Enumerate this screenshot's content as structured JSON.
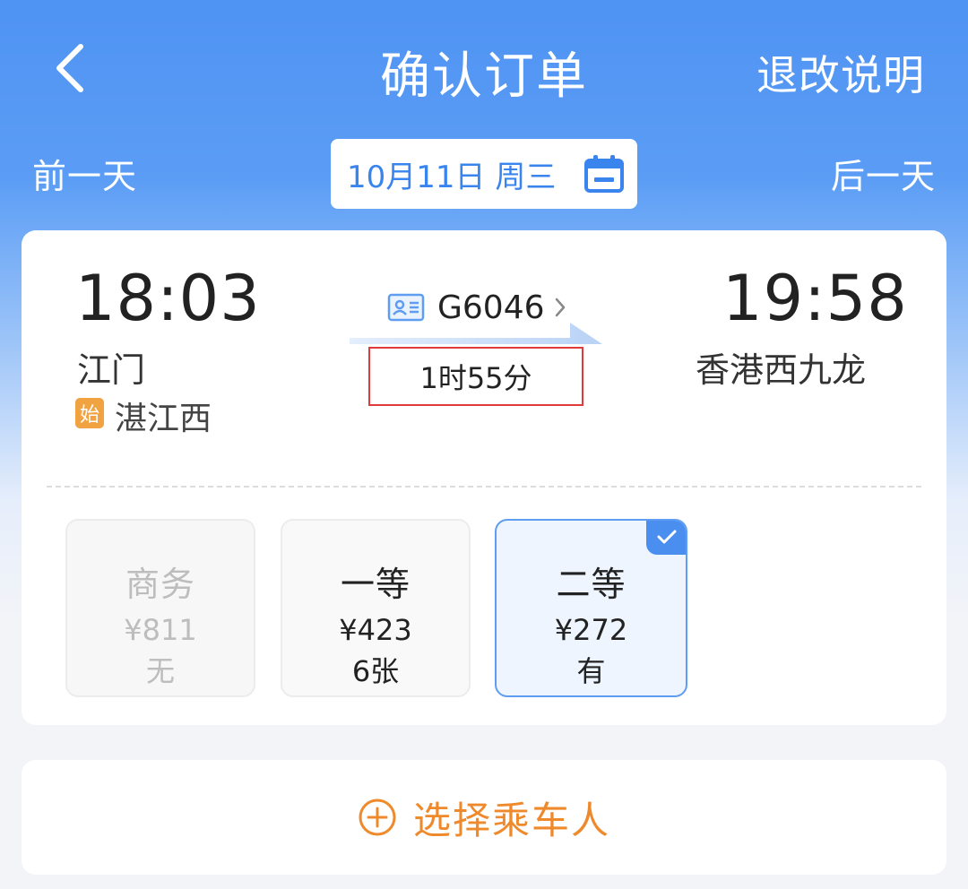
{
  "header": {
    "title": "确认订单",
    "rules_label": "退改说明",
    "back_icon": "chevron-left-icon"
  },
  "date_bar": {
    "prev_label": "前一天",
    "next_label": "后一天",
    "date_text": "10月11日 周三",
    "calendar_icon": "calendar-icon"
  },
  "train": {
    "departure_time": "18:03",
    "departure_station": "江门",
    "arrival_time": "19:58",
    "arrival_station": "香港西九龙",
    "origin_badge": "始",
    "origin_station": "湛江西",
    "train_number": "G6046",
    "duration": "1时55分"
  },
  "seats": [
    {
      "name": "商务",
      "price": "¥811",
      "availability": "无",
      "state": "disabled"
    },
    {
      "name": "一等",
      "price": "¥423",
      "availability": "6张",
      "state": "available"
    },
    {
      "name": "二等",
      "price": "¥272",
      "availability": "有",
      "state": "selected"
    }
  ],
  "passenger": {
    "select_label": "选择乘车人"
  },
  "colors": {
    "primary_blue": "#4f93f3",
    "accent_orange": "#ef8a2c",
    "badge_orange": "#f2a341",
    "highlight_red": "#e03b3b",
    "selected_border": "#5e9df2"
  }
}
